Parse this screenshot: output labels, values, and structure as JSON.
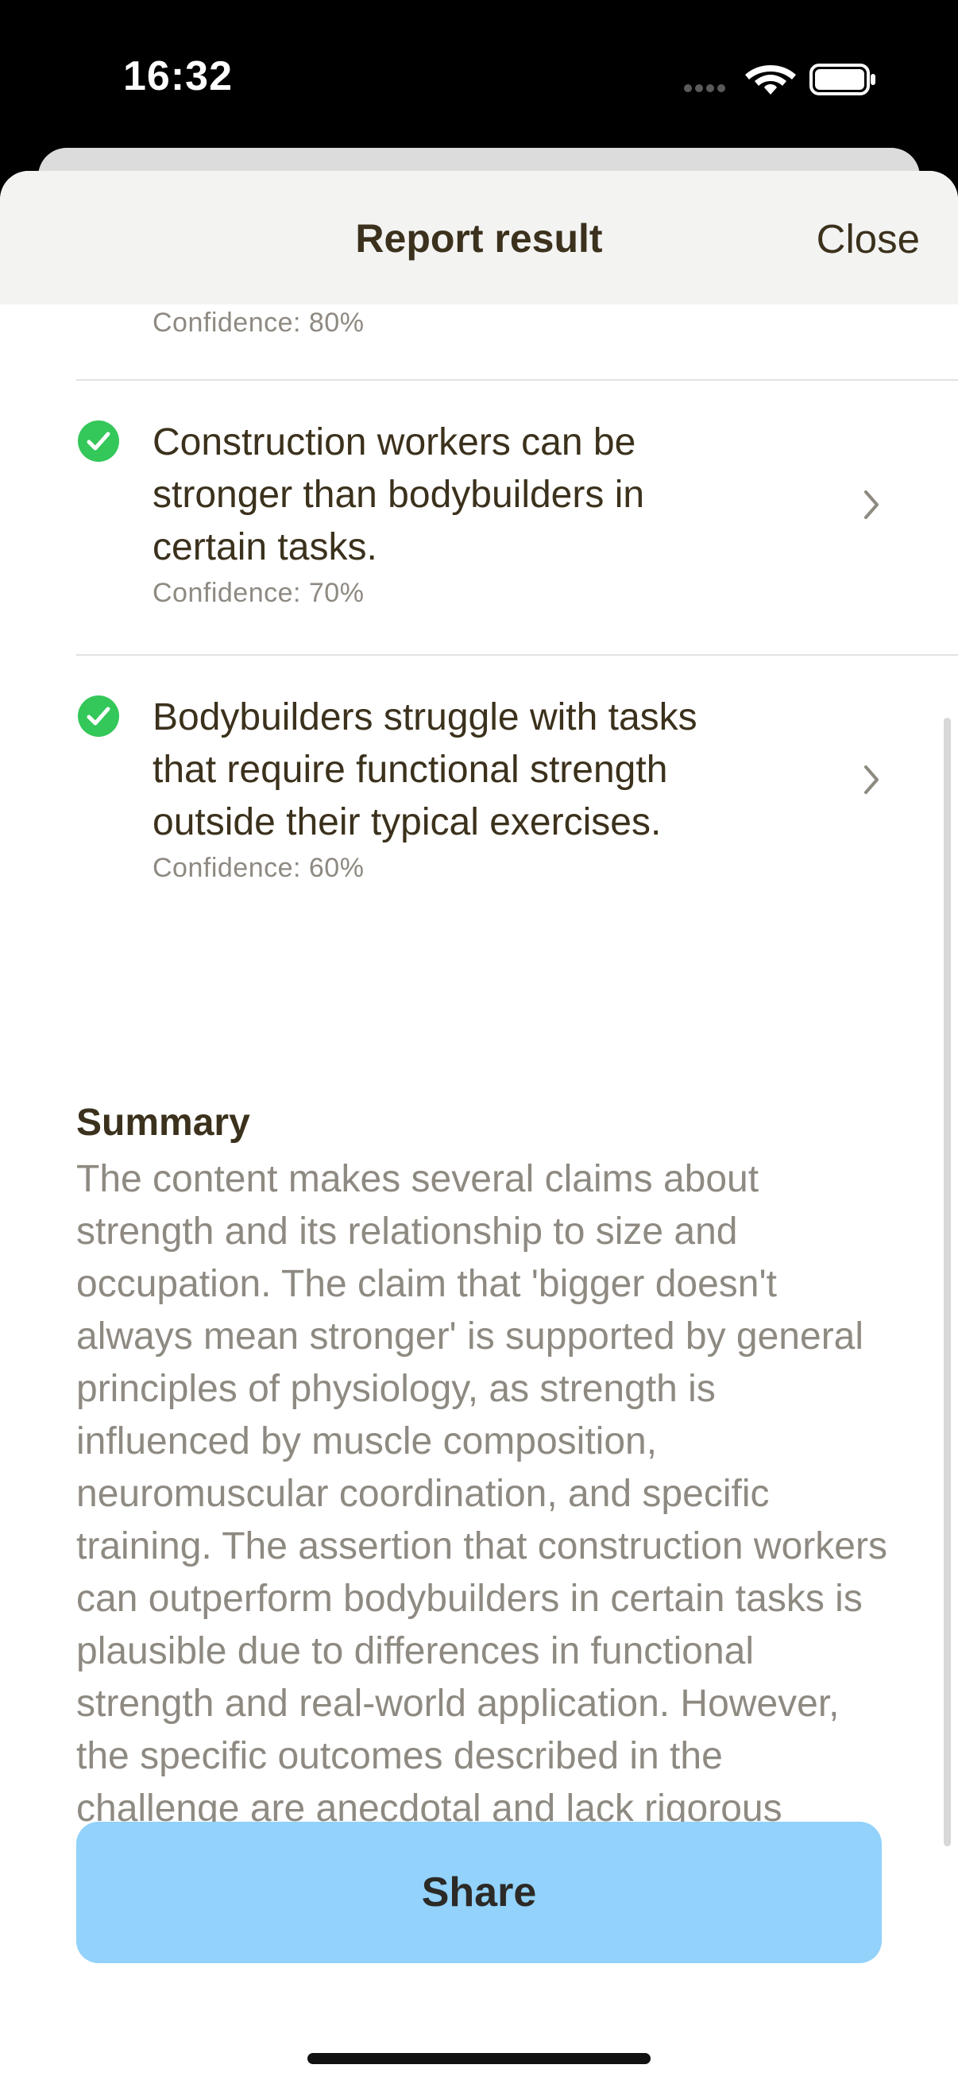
{
  "status_bar": {
    "time": "16:32"
  },
  "nav": {
    "title": "Report result",
    "close_label": "Close"
  },
  "claims": [
    {
      "text": "",
      "confidence": "Confidence: 80%"
    },
    {
      "text": "Construction workers can be stronger than bodybuilders in certain tasks.",
      "confidence": "Confidence: 70%"
    },
    {
      "text": "Bodybuilders struggle with tasks that require functional strength outside their typical exercises.",
      "confidence": "Confidence: 60%"
    }
  ],
  "summary": {
    "title": "Summary",
    "text": "The content makes several claims about strength and its relationship to size and occupation. The claim that 'bigger doesn't always mean stronger' is supported by general principles of physiology, as strength is influenced by muscle composition, neuromuscular coordination, and specific training. The assertion that construction workers can outperform bodybuilders in certain tasks is plausible due to differences in functional strength and real-world application. However, the specific outcomes described in the challenge are anecdotal and lack rigorous scientific validation."
  },
  "share_label": "Share",
  "colors": {
    "accent": "#92d2fb",
    "check_green": "#34c759",
    "text_primary": "#3b311c",
    "text_secondary": "#8e8a82"
  },
  "icons": [
    "signal-dots-icon",
    "wifi-icon",
    "battery-icon",
    "checkmark-circle-icon",
    "chevron-right-icon"
  ]
}
